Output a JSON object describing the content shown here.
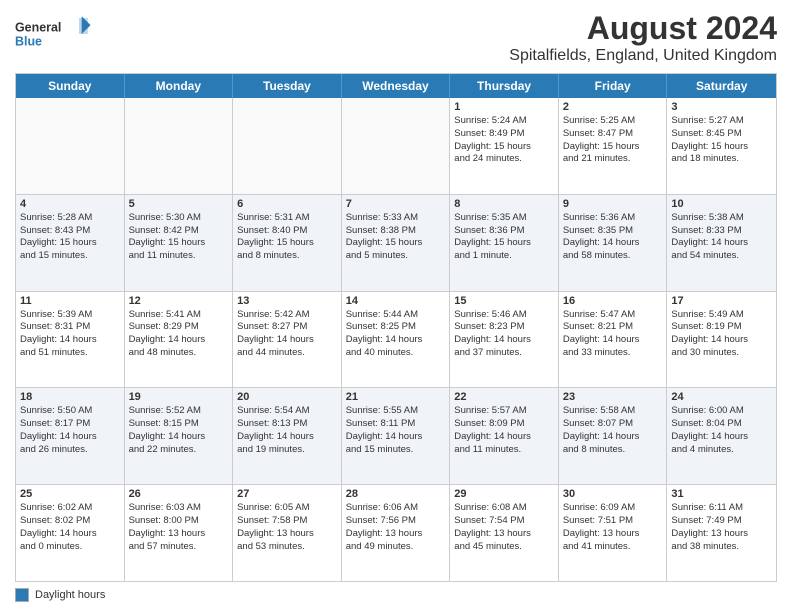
{
  "header": {
    "logo": {
      "general": "General",
      "blue": "Blue"
    },
    "title": "August 2024",
    "subtitle": "Spitalfields, England, United Kingdom"
  },
  "calendar": {
    "weekdays": [
      "Sunday",
      "Monday",
      "Tuesday",
      "Wednesday",
      "Thursday",
      "Friday",
      "Saturday"
    ],
    "rows": [
      [
        {
          "day": "",
          "lines": []
        },
        {
          "day": "",
          "lines": []
        },
        {
          "day": "",
          "lines": []
        },
        {
          "day": "",
          "lines": []
        },
        {
          "day": "1",
          "lines": [
            "Sunrise: 5:24 AM",
            "Sunset: 8:49 PM",
            "Daylight: 15 hours",
            "and 24 minutes."
          ]
        },
        {
          "day": "2",
          "lines": [
            "Sunrise: 5:25 AM",
            "Sunset: 8:47 PM",
            "Daylight: 15 hours",
            "and 21 minutes."
          ]
        },
        {
          "day": "3",
          "lines": [
            "Sunrise: 5:27 AM",
            "Sunset: 8:45 PM",
            "Daylight: 15 hours",
            "and 18 minutes."
          ]
        }
      ],
      [
        {
          "day": "4",
          "lines": [
            "Sunrise: 5:28 AM",
            "Sunset: 8:43 PM",
            "Daylight: 15 hours",
            "and 15 minutes."
          ]
        },
        {
          "day": "5",
          "lines": [
            "Sunrise: 5:30 AM",
            "Sunset: 8:42 PM",
            "Daylight: 15 hours",
            "and 11 minutes."
          ]
        },
        {
          "day": "6",
          "lines": [
            "Sunrise: 5:31 AM",
            "Sunset: 8:40 PM",
            "Daylight: 15 hours",
            "and 8 minutes."
          ]
        },
        {
          "day": "7",
          "lines": [
            "Sunrise: 5:33 AM",
            "Sunset: 8:38 PM",
            "Daylight: 15 hours",
            "and 5 minutes."
          ]
        },
        {
          "day": "8",
          "lines": [
            "Sunrise: 5:35 AM",
            "Sunset: 8:36 PM",
            "Daylight: 15 hours",
            "and 1 minute."
          ]
        },
        {
          "day": "9",
          "lines": [
            "Sunrise: 5:36 AM",
            "Sunset: 8:35 PM",
            "Daylight: 14 hours",
            "and 58 minutes."
          ]
        },
        {
          "day": "10",
          "lines": [
            "Sunrise: 5:38 AM",
            "Sunset: 8:33 PM",
            "Daylight: 14 hours",
            "and 54 minutes."
          ]
        }
      ],
      [
        {
          "day": "11",
          "lines": [
            "Sunrise: 5:39 AM",
            "Sunset: 8:31 PM",
            "Daylight: 14 hours",
            "and 51 minutes."
          ]
        },
        {
          "day": "12",
          "lines": [
            "Sunrise: 5:41 AM",
            "Sunset: 8:29 PM",
            "Daylight: 14 hours",
            "and 48 minutes."
          ]
        },
        {
          "day": "13",
          "lines": [
            "Sunrise: 5:42 AM",
            "Sunset: 8:27 PM",
            "Daylight: 14 hours",
            "and 44 minutes."
          ]
        },
        {
          "day": "14",
          "lines": [
            "Sunrise: 5:44 AM",
            "Sunset: 8:25 PM",
            "Daylight: 14 hours",
            "and 40 minutes."
          ]
        },
        {
          "day": "15",
          "lines": [
            "Sunrise: 5:46 AM",
            "Sunset: 8:23 PM",
            "Daylight: 14 hours",
            "and 37 minutes."
          ]
        },
        {
          "day": "16",
          "lines": [
            "Sunrise: 5:47 AM",
            "Sunset: 8:21 PM",
            "Daylight: 14 hours",
            "and 33 minutes."
          ]
        },
        {
          "day": "17",
          "lines": [
            "Sunrise: 5:49 AM",
            "Sunset: 8:19 PM",
            "Daylight: 14 hours",
            "and 30 minutes."
          ]
        }
      ],
      [
        {
          "day": "18",
          "lines": [
            "Sunrise: 5:50 AM",
            "Sunset: 8:17 PM",
            "Daylight: 14 hours",
            "and 26 minutes."
          ]
        },
        {
          "day": "19",
          "lines": [
            "Sunrise: 5:52 AM",
            "Sunset: 8:15 PM",
            "Daylight: 14 hours",
            "and 22 minutes."
          ]
        },
        {
          "day": "20",
          "lines": [
            "Sunrise: 5:54 AM",
            "Sunset: 8:13 PM",
            "Daylight: 14 hours",
            "and 19 minutes."
          ]
        },
        {
          "day": "21",
          "lines": [
            "Sunrise: 5:55 AM",
            "Sunset: 8:11 PM",
            "Daylight: 14 hours",
            "and 15 minutes."
          ]
        },
        {
          "day": "22",
          "lines": [
            "Sunrise: 5:57 AM",
            "Sunset: 8:09 PM",
            "Daylight: 14 hours",
            "and 11 minutes."
          ]
        },
        {
          "day": "23",
          "lines": [
            "Sunrise: 5:58 AM",
            "Sunset: 8:07 PM",
            "Daylight: 14 hours",
            "and 8 minutes."
          ]
        },
        {
          "day": "24",
          "lines": [
            "Sunrise: 6:00 AM",
            "Sunset: 8:04 PM",
            "Daylight: 14 hours",
            "and 4 minutes."
          ]
        }
      ],
      [
        {
          "day": "25",
          "lines": [
            "Sunrise: 6:02 AM",
            "Sunset: 8:02 PM",
            "Daylight: 14 hours",
            "and 0 minutes."
          ]
        },
        {
          "day": "26",
          "lines": [
            "Sunrise: 6:03 AM",
            "Sunset: 8:00 PM",
            "Daylight: 13 hours",
            "and 57 minutes."
          ]
        },
        {
          "day": "27",
          "lines": [
            "Sunrise: 6:05 AM",
            "Sunset: 7:58 PM",
            "Daylight: 13 hours",
            "and 53 minutes."
          ]
        },
        {
          "day": "28",
          "lines": [
            "Sunrise: 6:06 AM",
            "Sunset: 7:56 PM",
            "Daylight: 13 hours",
            "and 49 minutes."
          ]
        },
        {
          "day": "29",
          "lines": [
            "Sunrise: 6:08 AM",
            "Sunset: 7:54 PM",
            "Daylight: 13 hours",
            "and 45 minutes."
          ]
        },
        {
          "day": "30",
          "lines": [
            "Sunrise: 6:09 AM",
            "Sunset: 7:51 PM",
            "Daylight: 13 hours",
            "and 41 minutes."
          ]
        },
        {
          "day": "31",
          "lines": [
            "Sunrise: 6:11 AM",
            "Sunset: 7:49 PM",
            "Daylight: 13 hours",
            "and 38 minutes."
          ]
        }
      ]
    ]
  },
  "footer": {
    "legend_label": "Daylight hours"
  }
}
